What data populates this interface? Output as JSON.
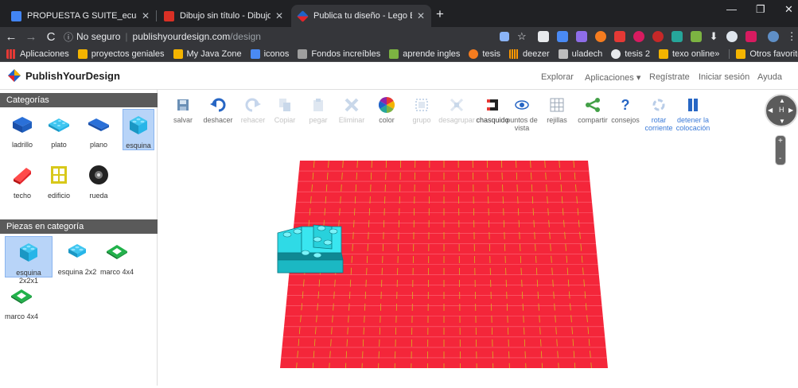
{
  "browser": {
    "tabs": [
      {
        "title": "PROPUESTA G SUITE_ecuaciones",
        "favicon_color": "#4285f4"
      },
      {
        "title": "Dibujo sin título - Dibujos de Go",
        "favicon_color": "#d93025"
      },
      {
        "title": "Publica tu diseño - Lego Builder",
        "favicon_color": "#1f63c8"
      }
    ],
    "url_host": "publishyourdesign.com",
    "url_path": "/design",
    "security_label": "No seguro",
    "bookmarks": [
      {
        "label": "Aplicaciones",
        "icon": "apps-icon"
      },
      {
        "label": "proyectos geniales",
        "icon": "bookmark-icon"
      },
      {
        "label": "My Java Zone",
        "icon": "bookmark-icon"
      },
      {
        "label": "iconos",
        "icon": "bookmark-icon"
      },
      {
        "label": "Fondos increíbles",
        "icon": "bookmark-icon"
      },
      {
        "label": "aprende ingles",
        "icon": "bookmark-icon"
      },
      {
        "label": "tesis",
        "icon": "bookmark-icon"
      },
      {
        "label": "deezer",
        "icon": "bookmark-icon"
      },
      {
        "label": "uladech",
        "icon": "bookmark-icon"
      },
      {
        "label": "tesis 2",
        "icon": "bookmark-icon"
      },
      {
        "label": "texo online",
        "icon": "bookmark-icon"
      }
    ],
    "bookmarks_overflow": "»",
    "other_bookmarks": "Otros favoritos"
  },
  "site": {
    "logo_text": "PublishYourDesign",
    "nav": [
      "Explorar",
      "Aplicaciones ▾",
      "Regístrate",
      "Iniciar sesión",
      "Ayuda"
    ]
  },
  "sidebar": {
    "categories_title": "Categorías",
    "categories": [
      {
        "label": "ladrillo",
        "icon": "brick-icon",
        "color": "#1f5fbf"
      },
      {
        "label": "plato",
        "icon": "plate-icon",
        "color": "#27b5e8"
      },
      {
        "label": "plano",
        "icon": "flat-tile-icon",
        "color": "#1f5fbf"
      },
      {
        "label": "esquina",
        "icon": "corner-icon",
        "color": "#27b5e8",
        "selected": true
      },
      {
        "label": "techo",
        "icon": "roof-icon",
        "color": "#e3242b"
      },
      {
        "label": "edificio",
        "icon": "building-window-icon",
        "color": "#d8c81a"
      },
      {
        "label": "rueda",
        "icon": "wheel-icon",
        "color": "#222222"
      }
    ],
    "pieces_title": "Piezas en categoría",
    "pieces": [
      {
        "label": "esquina 2x2x1",
        "icon": "corner-icon",
        "color": "#27b5e8",
        "selected": true
      },
      {
        "label": "esquina 2x2",
        "icon": "corner-icon",
        "color": "#27b5e8"
      },
      {
        "label": "marco 4x4",
        "icon": "frame-icon",
        "color": "#21b24a"
      },
      {
        "label": "marco 4x4",
        "icon": "frame-icon",
        "color": "#21b24a"
      }
    ]
  },
  "tools": [
    {
      "label": "salvar",
      "icon": "save-icon",
      "state": "normal"
    },
    {
      "label": "deshacer",
      "icon": "undo-icon",
      "state": "normal"
    },
    {
      "label": "rehacer",
      "icon": "redo-icon",
      "state": "disabled"
    },
    {
      "label": "Copiar",
      "icon": "copy-icon",
      "state": "disabled"
    },
    {
      "label": "pegar",
      "icon": "paste-icon",
      "state": "disabled"
    },
    {
      "label": "Eliminar",
      "icon": "delete-icon",
      "state": "disabled"
    },
    {
      "label": "color",
      "icon": "color-wheel-icon",
      "state": "normal"
    },
    {
      "label": "grupo",
      "icon": "group-icon",
      "state": "disabled"
    },
    {
      "label": "desagrupar",
      "icon": "ungroup-icon",
      "state": "disabled"
    },
    {
      "label": "chasquido",
      "icon": "magnet-icon",
      "state": "normal"
    },
    {
      "label": "puntos de vista",
      "icon": "eye-icon",
      "state": "normal"
    },
    {
      "label": "rejillas",
      "icon": "grid-icon",
      "state": "normal"
    },
    {
      "label": "compartir",
      "icon": "share-icon",
      "state": "normal"
    },
    {
      "label": "consejos",
      "icon": "help-icon",
      "state": "normal"
    },
    {
      "label": "rotar corriente",
      "icon": "rotate-icon",
      "state": "active"
    },
    {
      "label": "detener la colocación",
      "icon": "pause-icon",
      "state": "active"
    }
  ],
  "canvas": {
    "baseplate_color": "#f4263a",
    "stud_line_color": "#d4b820",
    "piece_color": "#2fdae6"
  },
  "controls": {
    "nav_label": "H",
    "zoom_in": "+",
    "zoom_out": "-"
  }
}
